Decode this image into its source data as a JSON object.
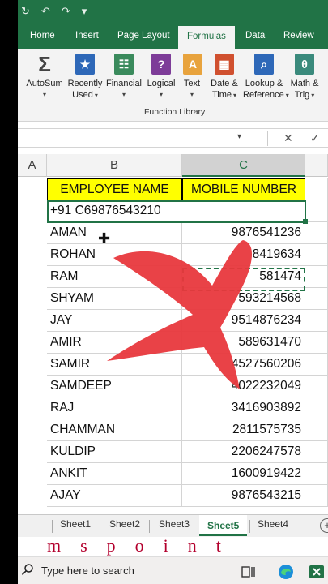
{
  "qat": {
    "autosave": "↻",
    "undo": "↶",
    "redo": "↷",
    "more": "▾"
  },
  "tabs": [
    {
      "label": "Home"
    },
    {
      "label": "Insert"
    },
    {
      "label": "Page Layout"
    },
    {
      "label": "Formulas",
      "active": true
    },
    {
      "label": "Data"
    },
    {
      "label": "Review"
    }
  ],
  "ribbon": {
    "functions": [
      {
        "label": "AutoSum",
        "sub": "",
        "icon": "sigma-icon",
        "color": "#444444",
        "glyph": "Σ"
      },
      {
        "label": "Recently",
        "sub": "Used",
        "icon": "star-book-icon",
        "color": "#2e68b8",
        "glyph": "★"
      },
      {
        "label": "Financial",
        "sub": "",
        "icon": "ledger-icon",
        "color": "#3a8a5c",
        "glyph": "☷"
      },
      {
        "label": "Logical",
        "sub": "",
        "icon": "question-book-icon",
        "color": "#7d3c98",
        "glyph": "?"
      },
      {
        "label": "Text",
        "sub": "",
        "icon": "text-a-icon",
        "color": "#e8a33d",
        "glyph": "A"
      },
      {
        "label": "Date &",
        "sub": "Time",
        "icon": "calendar-icon",
        "color": "#d0502f",
        "glyph": "▦"
      },
      {
        "label": "Lookup &",
        "sub": "Reference",
        "icon": "magnifier-book-icon",
        "color": "#2e68b8",
        "glyph": "⌕"
      },
      {
        "label": "Math &",
        "sub": "Trig",
        "icon": "theta-book-icon",
        "color": "#3a8a7c",
        "glyph": "θ"
      }
    ],
    "group_label": "Function Library"
  },
  "formula_bar": {
    "cancel": "✕",
    "enter": "✓",
    "dropdown": "▾"
  },
  "columns": {
    "a": "A",
    "b": "B",
    "c": "C"
  },
  "sheet": {
    "header": {
      "name": "EMPLOYEE NAME",
      "mobile": "MOBILE NUMBER"
    },
    "merged_row": "+91 C69876543210",
    "rows": [
      {
        "name": "AMAN",
        "mobile": "9876541236"
      },
      {
        "name": "ROHAN",
        "mobile": "8419634"
      },
      {
        "name": "RAM",
        "mobile": "581474"
      },
      {
        "name": "SHYAM",
        "mobile": "593214568"
      },
      {
        "name": "JAY",
        "mobile": "9514876234"
      },
      {
        "name": "AMIR",
        "mobile": "589631470"
      },
      {
        "name": "SAMIR",
        "mobile": "4527560206"
      },
      {
        "name": "SAMDEEP",
        "mobile": "4022232049"
      },
      {
        "name": "RAJ",
        "mobile": "3416903892"
      },
      {
        "name": "CHAMMAN",
        "mobile": "2811575735"
      },
      {
        "name": "KULDIP",
        "mobile": "2206247578"
      },
      {
        "name": "ANKIT",
        "mobile": "1600919422"
      },
      {
        "name": "AJAY",
        "mobile": "9876543215"
      }
    ]
  },
  "sheet_tabs": [
    {
      "label": "Sheet1"
    },
    {
      "label": "Sheet2"
    },
    {
      "label": "Sheet3"
    },
    {
      "label": "Sheet5",
      "active": true
    },
    {
      "label": "Sheet4"
    }
  ],
  "watermark": "mspoint",
  "taskbar": {
    "search_placeholder": "Type here to search"
  },
  "colors": {
    "excel_green": "#217346",
    "header_fill": "#ffff00",
    "cross_red": "#e8383d",
    "watermark": "#b3002d"
  }
}
